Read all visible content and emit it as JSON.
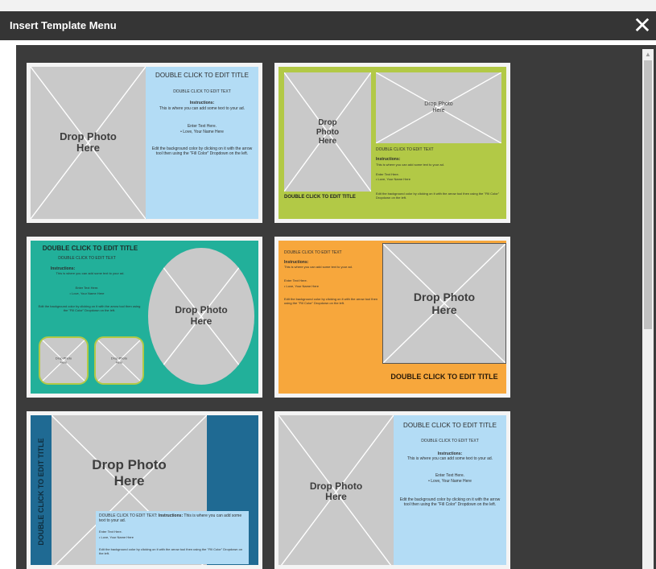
{
  "dialog": {
    "title": "Insert Template Menu",
    "close_glyph": "✕"
  },
  "scroll": {
    "up_arrow": "▲"
  },
  "common": {
    "drop_photo": "Drop Photo Here",
    "edit_title": "DOUBLE CLICK TO EDIT TITLE",
    "edit_text": "DOUBLE CLICK TO EDIT TEXT",
    "edit_text_colon": "DOUBLE CLICK TO EDIT TEXT:",
    "instructions_label": "Instructions:",
    "instructions_body": "This is where you can add some text to your ad.",
    "enter_text": "Enter Text Here.",
    "love": "• Love, Your Name Here",
    "bg_note": "Edit the background color by clicking on it with the arrow tool then using the \"Fill Color\" Dropdown on the left."
  },
  "colors": {
    "light_blue": "#b3dcf5",
    "lime": "#b2c946",
    "teal": "#22b09a",
    "orange": "#f7a73c",
    "navy": "#1f6a93",
    "photo": "#c9c9c9"
  },
  "templates": [
    {
      "name": "photo-left-blue-text"
    },
    {
      "name": "lime-two-photos"
    },
    {
      "name": "teal-oval-photos"
    },
    {
      "name": "orange-photo-right"
    },
    {
      "name": "navy-vertical-title"
    },
    {
      "name": "photo-left-blue-text-2"
    }
  ]
}
